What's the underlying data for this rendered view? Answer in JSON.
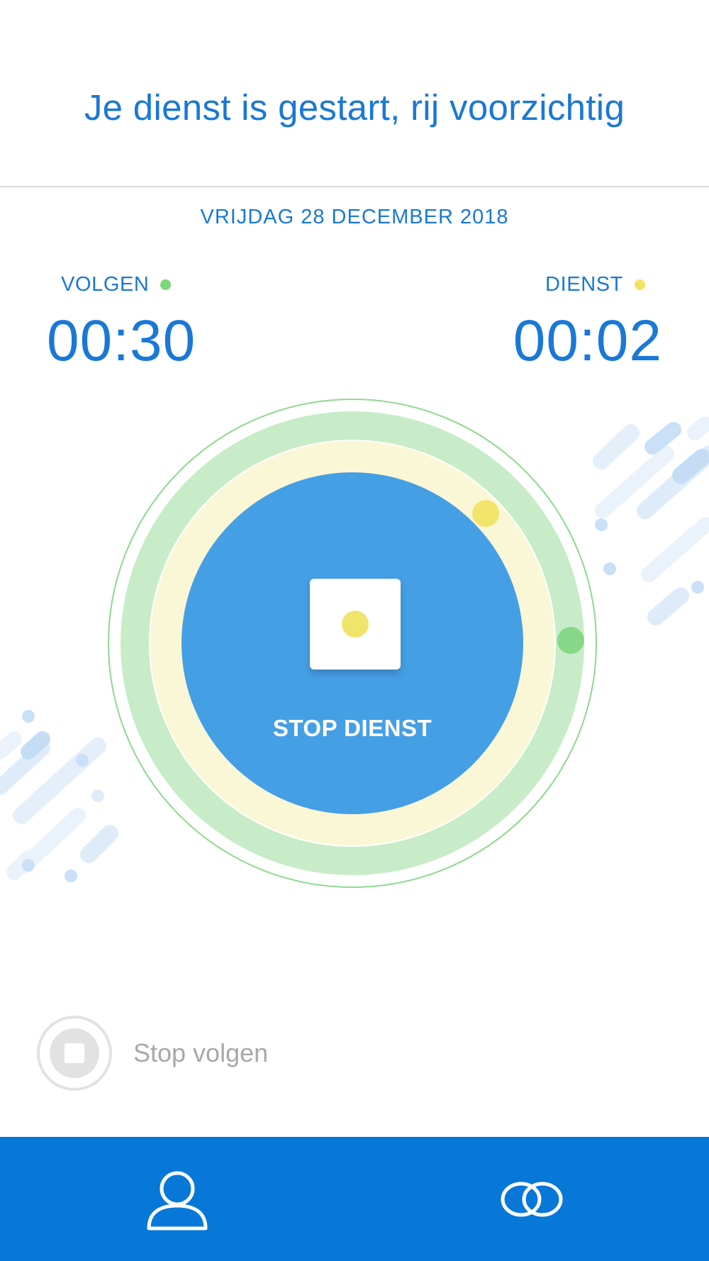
{
  "header": {
    "title": "Je dienst is gestart, rij voorzichtig"
  },
  "date": "VRIJDAG 28 DECEMBER 2018",
  "timers": {
    "volgen": {
      "label": "VOLGEN",
      "value": "00:30",
      "status_color": "#7cd67c"
    },
    "dienst": {
      "label": "DIENST",
      "value": "00:02",
      "status_color": "#f3e35f"
    }
  },
  "main_button": {
    "label": "STOP DIENST",
    "icon": "stop-square-icon"
  },
  "stop_follow": {
    "label": "Stop volgen",
    "icon": "stop-circle-icon"
  },
  "bottom_nav": [
    {
      "name": "profile",
      "icon": "user-icon"
    },
    {
      "name": "link",
      "icon": "link-icon"
    }
  ],
  "colors": {
    "accent": "#1a78d6",
    "button": "#459fe5",
    "bottom_bar": "#0878d8",
    "ring_green": "#c7ecc7",
    "ring_yellow": "#faf7d6"
  }
}
